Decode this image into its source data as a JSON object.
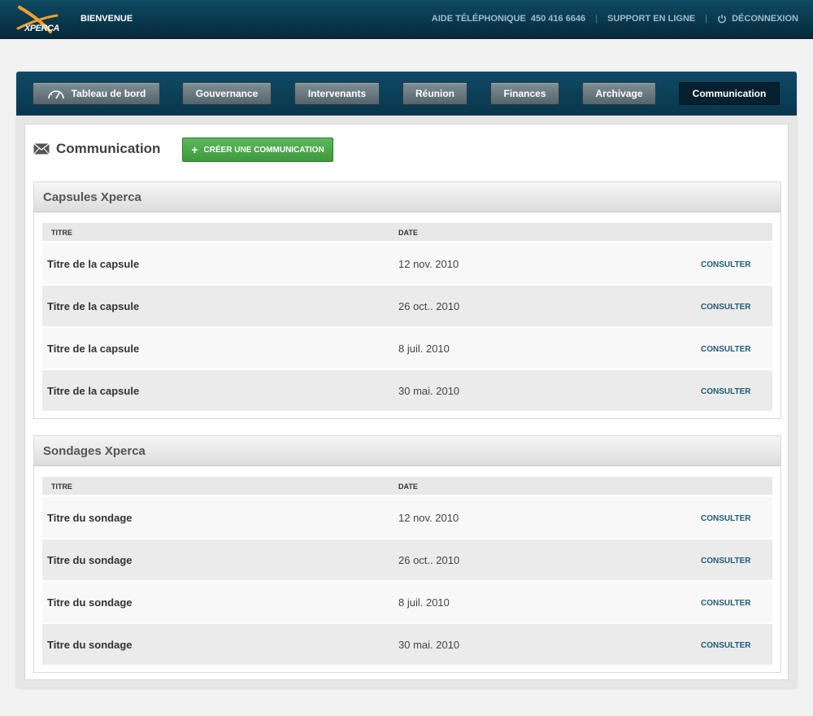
{
  "brand": {
    "name": "XPERCA"
  },
  "header": {
    "welcome": "BIENVENUE",
    "phone_label": "AIDE TÉLÉPHONIQUE",
    "phone_number": "450 416 6646",
    "support": "SUPPORT EN LIGNE",
    "logout": "DÉCONNEXION",
    "separator": "|"
  },
  "nav": {
    "tabs": [
      {
        "label": "Tableau de bord",
        "icon": "gauge-icon"
      },
      {
        "label": "Gouvernance"
      },
      {
        "label": "Intervenants"
      },
      {
        "label": "Réunion"
      },
      {
        "label": "Finances"
      },
      {
        "label": "Archivage"
      },
      {
        "label": "Communication",
        "active": true
      }
    ]
  },
  "page": {
    "title": "Communication",
    "icon": "mail-icon",
    "create_button": "CRÉER UNE COMMUNICATION",
    "create_icon": "+"
  },
  "sections": [
    {
      "title": "Capsules Xperca",
      "columns": [
        "TITRE",
        "DATE"
      ],
      "rows": [
        {
          "title": "Titre de la capsule",
          "date": "12 nov. 2010",
          "action": "CONSULTER"
        },
        {
          "title": "Titre de la capsule",
          "date": "26 oct.. 2010",
          "action": "CONSULTER"
        },
        {
          "title": "Titre de la capsule",
          "date": "8 juil. 2010",
          "action": "CONSULTER"
        },
        {
          "title": "Titre de la capsule",
          "date": "30 mai. 2010",
          "action": "CONSULTER"
        }
      ]
    },
    {
      "title": "Sondages Xperca",
      "columns": [
        "TITRE",
        "DATE"
      ],
      "rows": [
        {
          "title": "Titre du sondage",
          "date": "12 nov. 2010",
          "action": "CONSULTER"
        },
        {
          "title": "Titre du sondage",
          "date": "26 oct.. 2010",
          "action": "CONSULTER"
        },
        {
          "title": "Titre du sondage",
          "date": "8 juil. 2010",
          "action": "CONSULTER"
        },
        {
          "title": "Titre du sondage",
          "date": "30 mai. 2010",
          "action": "CONSULTER"
        }
      ]
    }
  ],
  "colors": {
    "topbar": "#0f4b63",
    "nav_band": "#0b3f58",
    "tab_active": "#05202e",
    "create_button": "#4cab4c",
    "link": "#1d5c7a",
    "logo_accent": "#f0a030"
  }
}
